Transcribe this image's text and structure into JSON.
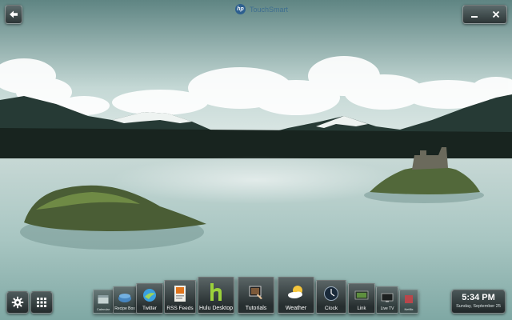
{
  "header": {
    "brand_logo": "hp",
    "app_name": "TouchSmart"
  },
  "window_controls": {
    "back_icon": "back-arrow-icon",
    "minimize_icon": "minimize-icon",
    "close_icon": "close-icon"
  },
  "toolbar": {
    "settings_icon": "gear-icon",
    "apps_icon": "grid-icon"
  },
  "dock": {
    "tiles": [
      {
        "label": "Calendar",
        "icon": "calendar-icon"
      },
      {
        "label": "Recipe Box",
        "icon": "recipe-box-icon"
      },
      {
        "label": "Twitter",
        "icon": "twitter-icon"
      },
      {
        "label": "RSS Feeds",
        "icon": "rss-feeds-icon"
      },
      {
        "label": "Hulu Desktop",
        "icon": "hulu-icon"
      },
      {
        "label": "Tutorials",
        "icon": "tutorials-icon"
      },
      {
        "label": "Weather",
        "icon": "weather-icon"
      },
      {
        "label": "Clock",
        "icon": "clock-icon"
      },
      {
        "label": "Link",
        "icon": "link-icon"
      },
      {
        "label": "Live TV",
        "icon": "live-tv-icon"
      },
      {
        "label": "Netflix",
        "icon": "netflix-icon"
      }
    ]
  },
  "status": {
    "time": "5:34 PM",
    "date": "Sunday, September 25"
  },
  "colors": {
    "sky": "#c9dcd9",
    "water": "#a9c7c3",
    "mountains": "#1d2b27",
    "tile_dark": "#262e2f",
    "brand_blue": "#2d5f8f"
  }
}
